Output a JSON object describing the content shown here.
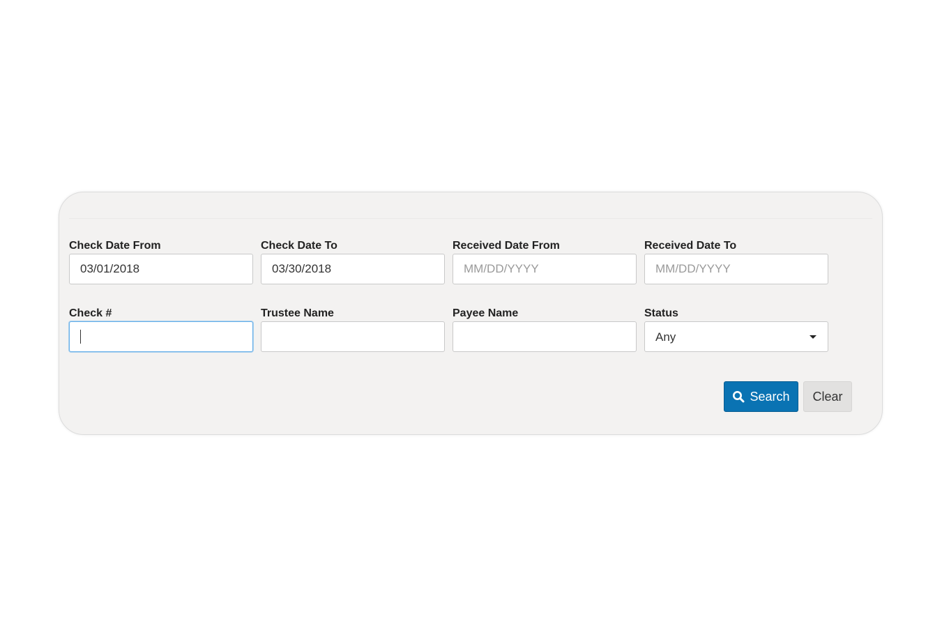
{
  "form": {
    "check_date_from": {
      "label": "Check Date From",
      "value": "03/01/2018",
      "placeholder": "MM/DD/YYYY"
    },
    "check_date_to": {
      "label": "Check Date To",
      "value": "03/30/2018",
      "placeholder": "MM/DD/YYYY"
    },
    "received_date_from": {
      "label": "Received Date From",
      "value": "",
      "placeholder": "MM/DD/YYYY"
    },
    "received_date_to": {
      "label": "Received Date To",
      "value": "",
      "placeholder": "MM/DD/YYYY"
    },
    "check_number": {
      "label": "Check #",
      "value": ""
    },
    "trustee_name": {
      "label": "Trustee Name",
      "value": ""
    },
    "payee_name": {
      "label": "Payee Name",
      "value": ""
    },
    "status": {
      "label": "Status",
      "selected": "Any"
    }
  },
  "actions": {
    "search_label": "Search",
    "clear_label": "Clear",
    "search_icon": "search-icon"
  },
  "colors": {
    "primary": "#0a73b3",
    "focus": "#66afe9",
    "panel_bg": "#f3f2f1"
  }
}
